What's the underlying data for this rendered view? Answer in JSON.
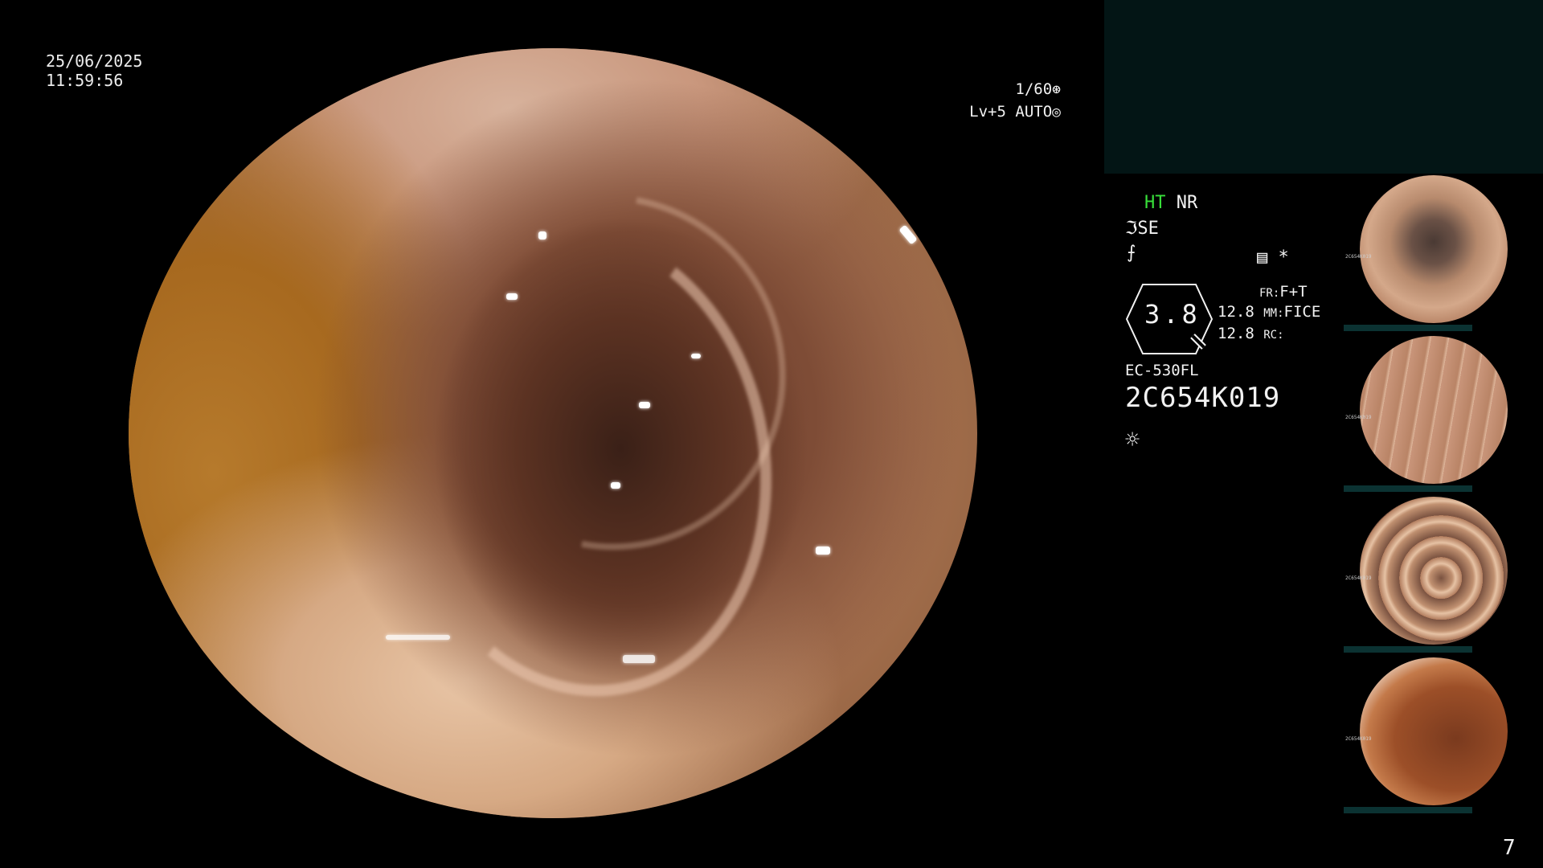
{
  "datetime": {
    "date": "25/06/2025",
    "time": "11:59:56"
  },
  "camera": {
    "shutter": "1/60",
    "shutter_icon": "aperture-icon",
    "level": "Lv+5",
    "mode": "AUTO",
    "mode_icon": "auto-iris-icon"
  },
  "status": {
    "ht": "HT",
    "nr": "NR",
    "se": "SE",
    "se_icon": "structure-enhancement-icon",
    "f_icon": "freeze-icon",
    "record_icon": "record-icon",
    "asterisk": "*"
  },
  "zoom": {
    "value": "3.8",
    "icon": "zoom-indicator-icon"
  },
  "settings": {
    "v1": "12.8",
    "v2": "12.8",
    "fr_key": "FR:",
    "fr_val": "F+T",
    "mm_key": "MM:",
    "mm_val": "FICE",
    "rc_key": "RC:"
  },
  "scope": {
    "model": "EC-530FL",
    "serial": "2C654K019",
    "light_icon": "light-source-icon"
  },
  "thumbnails": [
    {
      "label": "2C654K019",
      "tone": "lumen-deep"
    },
    {
      "label": "2C654K019",
      "tone": "folds"
    },
    {
      "label": "2C654K019",
      "tone": "rings"
    },
    {
      "label": "2C654K019",
      "tone": "wall"
    }
  ],
  "page_number": "7",
  "colors": {
    "accent_green": "#38e03a",
    "panel": "#031515",
    "text": "#f2f2f2"
  }
}
